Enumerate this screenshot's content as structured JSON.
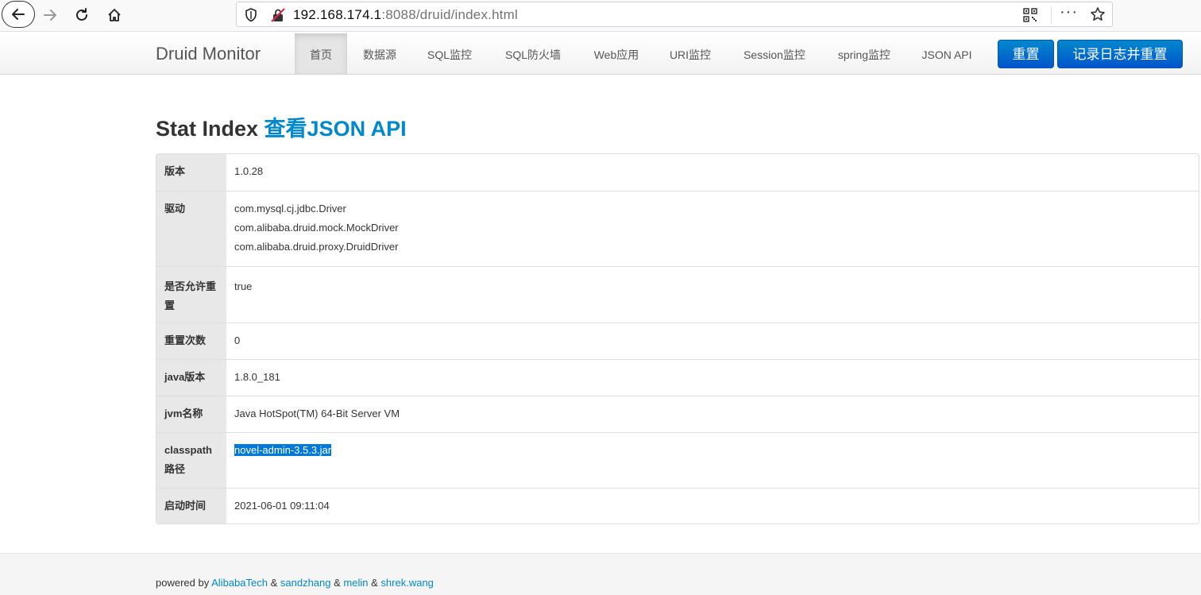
{
  "browser": {
    "url_host": "192.168.174.1",
    "url_rest": ":8088/druid/index.html"
  },
  "navbar": {
    "brand": "Druid Monitor",
    "items": [
      "首页",
      "数据源",
      "SQL监控",
      "SQL防火墙",
      "Web应用",
      "URI监控",
      "Session监控",
      "spring监控",
      "JSON API"
    ],
    "active_index": 0,
    "reset_button": "重置",
    "log_reset_button": "记录日志并重置",
    "button_color": "#0077cc"
  },
  "main": {
    "title": "Stat Index",
    "title_link": "查看JSON API",
    "rows": [
      {
        "key": "版本",
        "values": [
          "1.0.28"
        ]
      },
      {
        "key": "驱动",
        "values": [
          "com.mysql.cj.jdbc.Driver",
          "com.alibaba.druid.mock.MockDriver",
          "com.alibaba.druid.proxy.DruidDriver"
        ]
      },
      {
        "key": "是否允许重置",
        "values": [
          "true"
        ]
      },
      {
        "key": "重置次数",
        "values": [
          "0"
        ]
      },
      {
        "key": "java版本",
        "values": [
          "1.8.0_181"
        ]
      },
      {
        "key": "jvm名称",
        "values": [
          "Java HotSpot(TM) 64-Bit Server VM"
        ]
      },
      {
        "key": "classpath路径",
        "values": [
          "novel-admin-3.5.3.jar"
        ]
      },
      {
        "key": "启动时间",
        "values": [
          "2021-06-01 09:11:04"
        ]
      }
    ]
  },
  "footer": {
    "prefix": "powered by",
    "links": [
      "AlibabaTech",
      "sandzhang",
      "melin",
      "shrek.wang"
    ],
    "separator": "&"
  }
}
